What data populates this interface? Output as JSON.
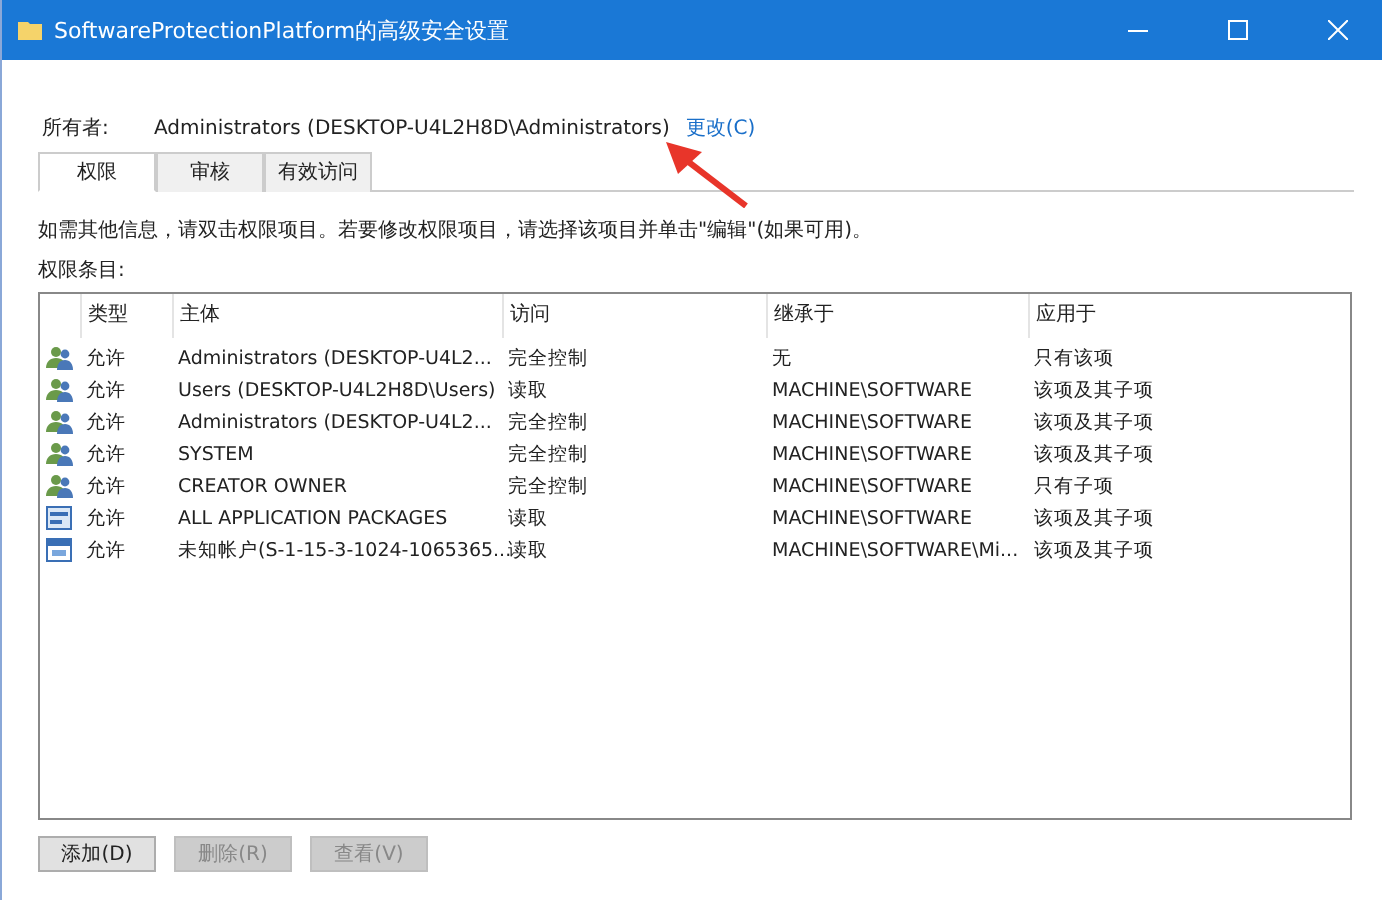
{
  "window": {
    "title": "SoftwareProtectionPlatform的高级安全设置"
  },
  "owner": {
    "label": "所有者:",
    "value": "Administrators (DESKTOP-U4L2H8D\\Administrators)",
    "change_link": "更改(C)"
  },
  "tabs": [
    {
      "label": "权限",
      "selected": true
    },
    {
      "label": "审核",
      "selected": false
    },
    {
      "label": "有效访问",
      "selected": false
    }
  ],
  "info": "如需其他信息，请双击权限项目。若要修改权限项目，请选择该项目并单击\"编辑\"(如果可用)。",
  "list_label": "权限条目:",
  "table": {
    "columns": [
      "类型",
      "主体",
      "访问",
      "继承于",
      "应用于"
    ],
    "rows": [
      {
        "kind": "group",
        "cells": [
          "允许",
          "Administrators (DESKTOP-U4L2...",
          "完全控制",
          "无",
          "只有该项"
        ]
      },
      {
        "kind": "group",
        "cells": [
          "允许",
          "Users (DESKTOP-U4L2H8D\\Users)",
          "读取",
          "MACHINE\\SOFTWARE",
          "该项及其子项"
        ]
      },
      {
        "kind": "group",
        "cells": [
          "允许",
          "Administrators (DESKTOP-U4L2...",
          "完全控制",
          "MACHINE\\SOFTWARE",
          "该项及其子项"
        ]
      },
      {
        "kind": "group",
        "cells": [
          "允许",
          "SYSTEM",
          "完全控制",
          "MACHINE\\SOFTWARE",
          "该项及其子项"
        ]
      },
      {
        "kind": "group",
        "cells": [
          "允许",
          "CREATOR OWNER",
          "完全控制",
          "MACHINE\\SOFTWARE",
          "只有子项"
        ]
      },
      {
        "kind": "app",
        "cells": [
          "允许",
          "ALL APPLICATION PACKAGES",
          "读取",
          "MACHINE\\SOFTWARE",
          "该项及其子项"
        ]
      },
      {
        "kind": "window",
        "cells": [
          "允许",
          "未知帐户(S-1-15-3-1024-1065365...",
          "读取",
          "MACHINE\\SOFTWARE\\Mi...",
          "该项及其子项"
        ]
      }
    ]
  },
  "buttons": [
    {
      "label": "添加(D)",
      "disabled": false
    },
    {
      "label": "删除(R)",
      "disabled": true
    },
    {
      "label": "查看(V)",
      "disabled": true
    }
  ]
}
